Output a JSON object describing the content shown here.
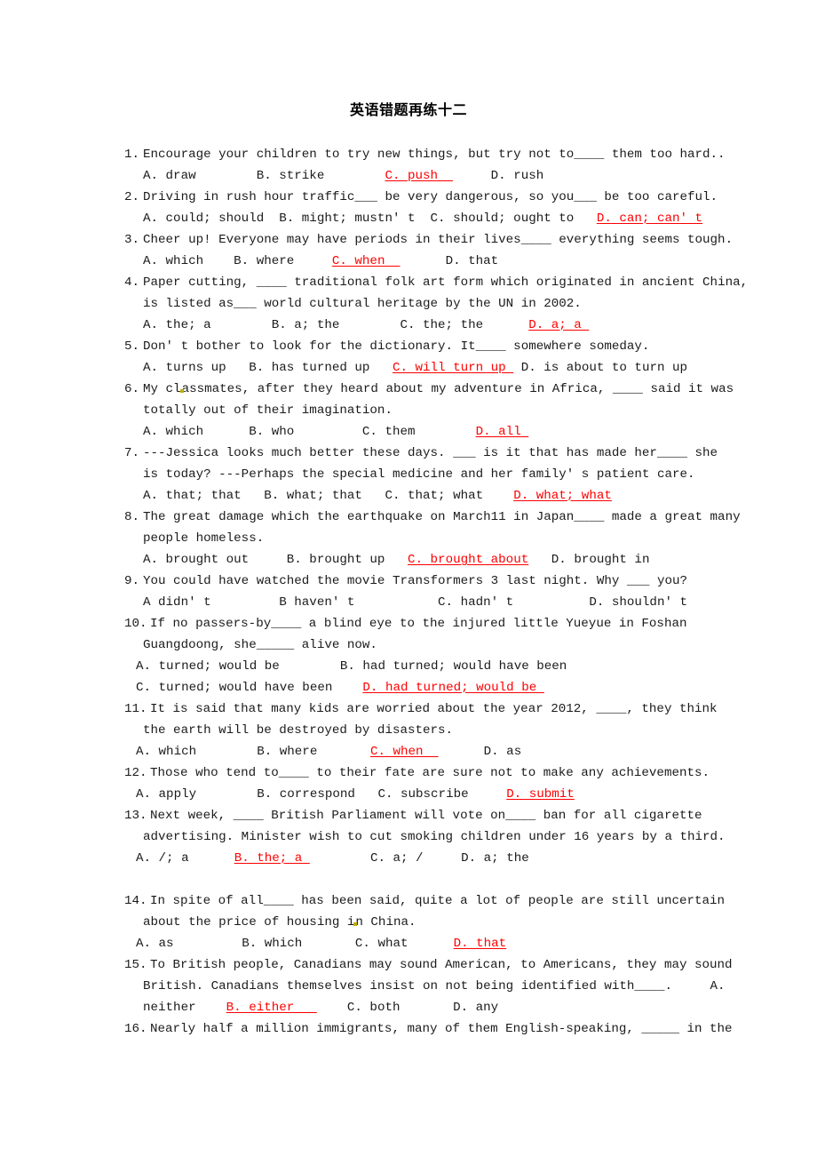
{
  "document": {
    "title": "英语错题再练十二",
    "answer_color": "#fe0000",
    "text_color": "#1b1b1b",
    "background": "#ffffff",
    "artifact_color": "#bdb000"
  },
  "questions": [
    {
      "number": "1.",
      "stem": "Encourage your children to try new things, but try not to____ them too hard..",
      "options_line": "A. draw        B. strike        ",
      "answer": "C. push  ",
      "options_tail": "     D. rush"
    },
    {
      "number": "2.",
      "stem": "Driving in rush hour traffic___ be very dangerous, so you___ be too careful.",
      "options_line": "A. could; should  B. might; mustn' t  C. should; ought to   ",
      "answer": "D. can; can' t",
      "options_tail": ""
    },
    {
      "number": "3.",
      "stem": "Cheer up! Everyone may have periods in their lives____ everything seems tough.",
      "options_line": "A. which    B. where     ",
      "answer": "C. when  ",
      "options_tail": "      D. that"
    },
    {
      "number": "4.",
      "stem": "Paper cutting, ____ traditional folk art form which originated in ancient China,",
      "continuation": "is listed as___ world cultural heritage by the UN in 2002.",
      "options_line": "A. the; a        B. a; the        C. the; the      ",
      "answer": "D. a; a ",
      "options_tail": ""
    },
    {
      "number": "5.",
      "stem": "Don' t bother to look for the dictionary. It____ somewhere someday.",
      "options_line": "A. turns up   B. has turned up   ",
      "answer": "C. will turn up ",
      "options_tail": " D. is about to turn up"
    },
    {
      "number": "6.",
      "stem_a": "My cl",
      "stem_b": "assmates, after they heard about my adventure in Africa, ____ said it was",
      "continuation": "totally out of their imagination.",
      "options_line": "A. which      B. who         C. them        ",
      "answer": "D. all ",
      "options_tail": ""
    },
    {
      "number": "7.",
      "stem": "---Jessica looks much better these days. ___ is it that has made her____ she",
      "continuation": "is today? ---Perhaps the special medicine and her family' s patient care.",
      "options_line": "A. that; that   B. what; that   C. that; what    ",
      "answer": "D. what; what",
      "options_tail": ""
    },
    {
      "number": "8.",
      "stem": "The great damage which the earthquake on March11 in Japan____ made a great many",
      "continuation": "people homeless.",
      "options_line": "A. brought out     B. brought up   ",
      "answer": "C. brought about",
      "options_tail": "   D. brought in"
    },
    {
      "number": "9.",
      "stem": "You could have watched the movie Transformers 3 last night. Why ___ you?",
      "options_line": "A didn' t         B haven' t           C. hadn' t          D. shouldn' t",
      "answer": "",
      "options_tail": ""
    },
    {
      "number": "10.",
      "stem": "If no passers-by____ a blind eye to the injured little Yueyue in Foshan",
      "continuation": "Guangdoong, she_____ alive now.",
      "options_line": "A. turned; would be        B. had turned; would have been",
      "options_line2": "C. turned; would have been    ",
      "answer": "D. had turned; would be ",
      "options_tail": ""
    },
    {
      "number": "11.",
      "stem": "It is said that many kids are worried about the year 2012, ____, they think",
      "continuation": "the earth will be destroyed by disasters.",
      "options_line": "A. which        B. where       ",
      "answer": "C. when  ",
      "options_tail": "      D. as"
    },
    {
      "number": "12.",
      "stem": "Those who tend to____ to their fate are sure not to make any achievements.",
      "options_line": "A. apply        B. correspond   C. subscribe     ",
      "answer": "D. submit",
      "options_tail": ""
    },
    {
      "number": "13.",
      "stem": "Next week, ____ British Parliament will vote on____ ban for all cigarette",
      "continuation": "advertising. Minister wish to cut smoking children under 16 years by a third.",
      "options_line": "A. /; a      ",
      "answer": "B. the; a ",
      "options_tail": "        C. a; /     D. a; the"
    },
    {
      "number": "14.",
      "stem": "In spite of all____ has been said, quite a lot of people are still uncertain",
      "continuation_a": "about the price of housing i",
      "continuation_b": "n China.",
      "options_line": "A. as         B. which       C. what      ",
      "answer": "D. that",
      "options_tail": ""
    },
    {
      "number": "15.",
      "stem": "To British people, Canadians may sound American, to Americans, they may sound",
      "continuation": "British. Canadians themselves insist on not being identified with____.     A.",
      "options_line": "neither    ",
      "answer": "B. either   ",
      "options_tail": "    C. both       D. any"
    },
    {
      "number": "16.",
      "stem": "Nearly half a million immigrants, many of them English-speaking, _____ in the",
      "options_line": "",
      "answer": "",
      "options_tail": ""
    }
  ]
}
